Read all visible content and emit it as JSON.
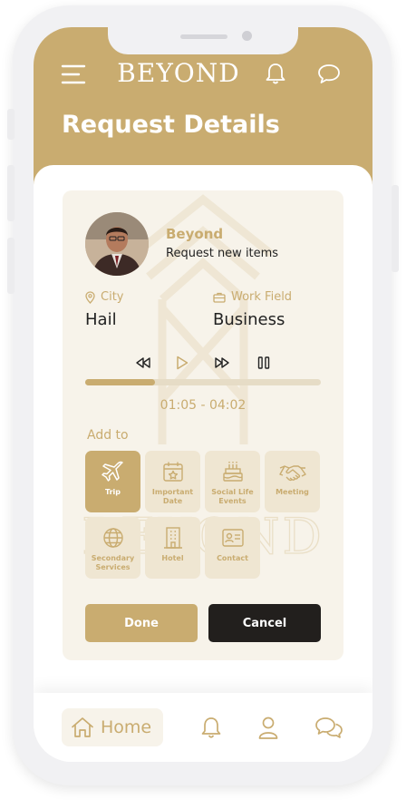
{
  "app": {
    "brand": "Beyond",
    "page_title": "Request Details"
  },
  "request": {
    "name": "Beyond",
    "subtitle": "Request new items",
    "city_label": "City",
    "city_value": "Hail",
    "work_label": "Work Field",
    "work_value": "Business"
  },
  "player": {
    "time": "01:05 - 04:02",
    "progress": 0.295
  },
  "add_to": {
    "label": "Add to",
    "items": [
      {
        "label": "Trip",
        "icon": "plane-icon",
        "active": true
      },
      {
        "label": "Important Date",
        "icon": "calendar-star-icon",
        "active": false
      },
      {
        "label": "Social Life Events",
        "icon": "cake-icon",
        "active": false
      },
      {
        "label": "Meeting",
        "icon": "handshake-icon",
        "active": false
      },
      {
        "label": "Secondary Services",
        "icon": "globe-icon",
        "active": false
      },
      {
        "label": "Hotel",
        "icon": "building-icon",
        "active": false
      },
      {
        "label": "Contact",
        "icon": "contact-card-icon",
        "active": false
      }
    ]
  },
  "actions": {
    "done": "Done",
    "cancel": "Cancel"
  },
  "nav": {
    "home": "Home"
  },
  "colors": {
    "accent": "#c9ac70",
    "dark": "#221f1d",
    "card": "#f7f3ea"
  }
}
